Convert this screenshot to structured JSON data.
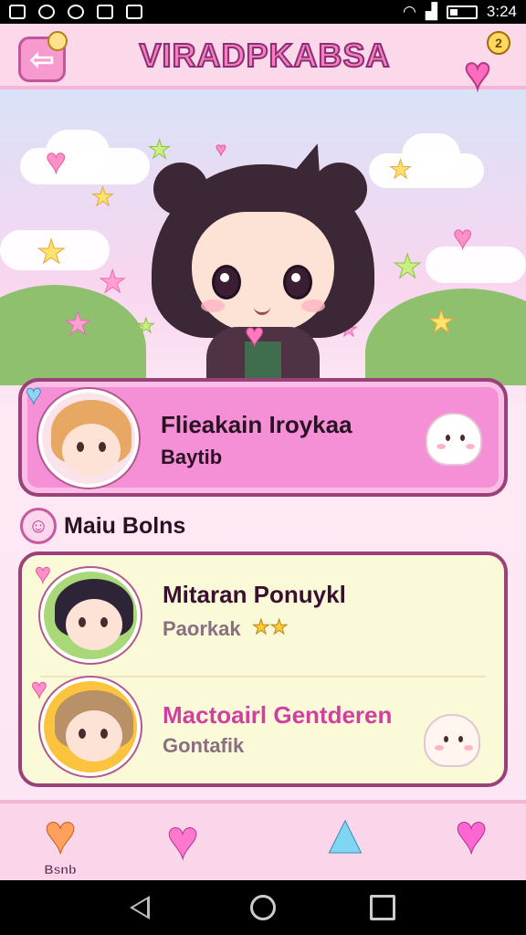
{
  "status_bar": {
    "time": "3:24"
  },
  "header": {
    "title": "VIRADPKABSA",
    "back_badge": "",
    "heart_badge": "2"
  },
  "profile_card": {
    "title": "Flieakain Iroykaa",
    "subtitle": "Baytib"
  },
  "section": {
    "title": "Maiu Bolns"
  },
  "list": {
    "items": [
      {
        "title": "Mitaran Ponuykl",
        "subtitle": "Paorkak",
        "stars": "★★"
      },
      {
        "title": "Mactoairl Gentderen",
        "subtitle": "Gontafik"
      }
    ]
  },
  "bottom_nav": {
    "items": [
      {
        "label": "Bsnb"
      }
    ]
  },
  "colors": {
    "header_bg": "#fbd8ea",
    "profile_card_bg": "#f590d7",
    "list_card_bg": "#fbfad8",
    "accent_pink": "#f57fbf"
  }
}
